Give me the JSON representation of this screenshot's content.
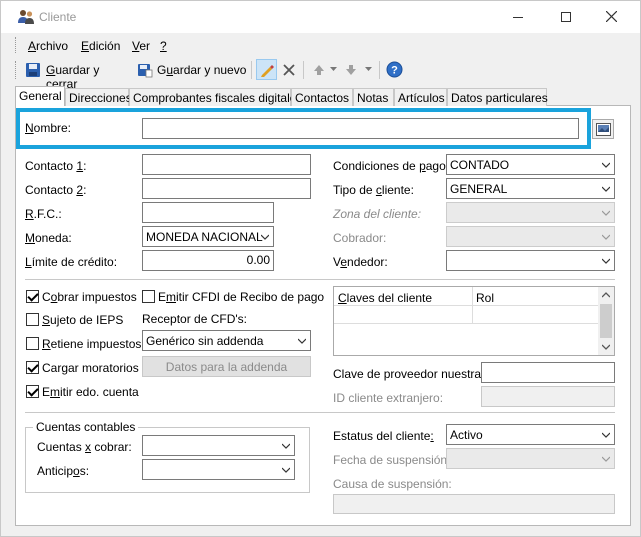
{
  "window": {
    "title": "Cliente"
  },
  "menu": [
    {
      "pre": "",
      "u": "A",
      "post": "rchivo"
    },
    {
      "pre": "",
      "u": "E",
      "post": "dición"
    },
    {
      "pre": "",
      "u": "V",
      "post": "er"
    },
    {
      "pre": "",
      "u": "?",
      "post": ""
    }
  ],
  "toolbar": {
    "save_close": {
      "pre": "",
      "u": "G",
      "post": "uardar y cerrar"
    },
    "save_new": {
      "pre": "G",
      "u": "u",
      "post": "ardar y nuevo"
    }
  },
  "tabs": [
    "General",
    "Direcciones",
    "Comprobantes fiscales digitales",
    "Contactos",
    "Notas",
    "Artículos",
    "Datos particulares"
  ],
  "form": {
    "nombre": {
      "pre": "",
      "u": "N",
      "post": "ombre:",
      "value": ""
    },
    "contacto1": {
      "pre": "Contacto ",
      "u": "1",
      "post": ":",
      "value": ""
    },
    "contacto2": {
      "pre": "Contacto ",
      "u": "2",
      "post": ":",
      "value": ""
    },
    "rfc": {
      "pre": "",
      "u": "R",
      "post": ".F.C.:",
      "value": ""
    },
    "moneda": {
      "pre": "",
      "u": "M",
      "post": "oneda:",
      "value": "MONEDA NACIONAL"
    },
    "limite": {
      "pre": "",
      "u": "L",
      "post": "ímite de crédito:",
      "value": "0.00"
    },
    "condiciones": {
      "pre": "Condiciones de ",
      "u": "p",
      "post": "ago:",
      "value": "CONTADO"
    },
    "tipo": {
      "pre": "Tipo de ",
      "u": "c",
      "post": "liente:",
      "value": "GENERAL"
    },
    "zona": {
      "label": "Zona del cliente:",
      "value": ""
    },
    "cobrador": {
      "label": "Cobrador:",
      "value": ""
    },
    "vendedor": {
      "pre": "V",
      "u": "e",
      "post": "ndedor:",
      "value": ""
    }
  },
  "checks": {
    "cobrar_impuestos": {
      "pre": "C",
      "u": "o",
      "post": "brar impuestos",
      "checked": true
    },
    "sujeto_ieps": {
      "pre": "",
      "u": "S",
      "post": "ujeto de IEPS",
      "checked": false
    },
    "retiene_impuestos": {
      "pre": "",
      "u": "R",
      "post": "etiene impuestos",
      "checked": false
    },
    "cargar_moratorios": {
      "pre": "Cargar moratorios",
      "u": "",
      "post": "",
      "checked": true
    },
    "emitir_edo": {
      "pre": "E",
      "u": "m",
      "post": "itir edo. cuenta",
      "checked": true
    },
    "emitir_cfdi": {
      "pre": "E",
      "u": "m",
      "post": "itir CFDI de Recibo de pago",
      "checked": false
    }
  },
  "receptor": {
    "label": "Receptor de CFD's:",
    "value": "Genérico sin addenda",
    "button": "Datos para la addenda"
  },
  "claves_table": {
    "headers": [
      {
        "pre": "",
        "u": "C",
        "post": "laves del cliente"
      },
      {
        "pre": "Rol",
        "u": "",
        "post": ""
      }
    ]
  },
  "clave_proveedor": {
    "label": "Clave de proveedor nuestra:",
    "value": ""
  },
  "id_extranjero": {
    "label": "ID cliente extranjero:",
    "value": ""
  },
  "cuentas_contables": {
    "title": "Cuentas contables",
    "cxc": {
      "pre": "Cuentas ",
      "u": "x",
      "post": " cobrar:",
      "value": ""
    },
    "anticipos": {
      "pre": "Anticip",
      "u": "o",
      "post": "s:",
      "value": ""
    }
  },
  "estatus": {
    "pre": "Estatus del cliente",
    "u": ":",
    "post": "",
    "value": "Activo"
  },
  "fecha_suspension": {
    "label": "Fecha de suspensión:",
    "value": ""
  },
  "causa_suspension": {
    "label": "Causa de suspensión:",
    "value": ""
  },
  "colors": {
    "highlight": "#1aa3dc",
    "accent": "#1a5fb4"
  }
}
